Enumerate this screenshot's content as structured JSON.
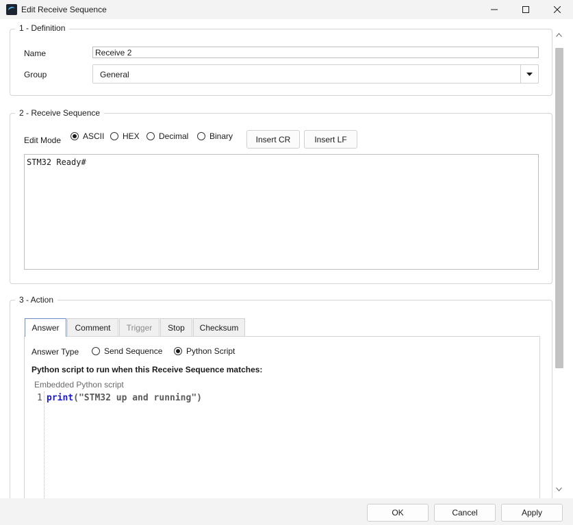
{
  "window": {
    "title": "Edit Receive Sequence"
  },
  "definition": {
    "section_label": "1 - Definition",
    "name_label": "Name",
    "name_value": "Receive 2",
    "group_label": "Group",
    "group_value": "General"
  },
  "receive": {
    "section_label": "2 - Receive Sequence",
    "edit_mode_label": "Edit Mode",
    "modes": [
      "ASCII",
      "HEX",
      "Decimal",
      "Binary"
    ],
    "selected_mode": "ASCII",
    "insert_cr": "Insert CR",
    "insert_lf": "Insert LF",
    "sequence_text": "STM32 Ready#"
  },
  "action": {
    "section_label": "3 - Action",
    "tabs": [
      "Answer",
      "Comment",
      "Trigger",
      "Stop",
      "Checksum"
    ],
    "active_tab": "Answer",
    "answer_type_label": "Answer Type",
    "answer_types": [
      "Send Sequence",
      "Python Script"
    ],
    "selected_answer_type": "Python Script",
    "script_prompt": "Python script to run when this Receive Sequence matches:",
    "embedded_label": "Embedded Python script",
    "code_line_number": "1",
    "code_keyword": "print",
    "code_rest": "(\"STM32 up and running\")"
  },
  "footer": {
    "ok": "OK",
    "cancel": "Cancel",
    "apply": "Apply"
  }
}
